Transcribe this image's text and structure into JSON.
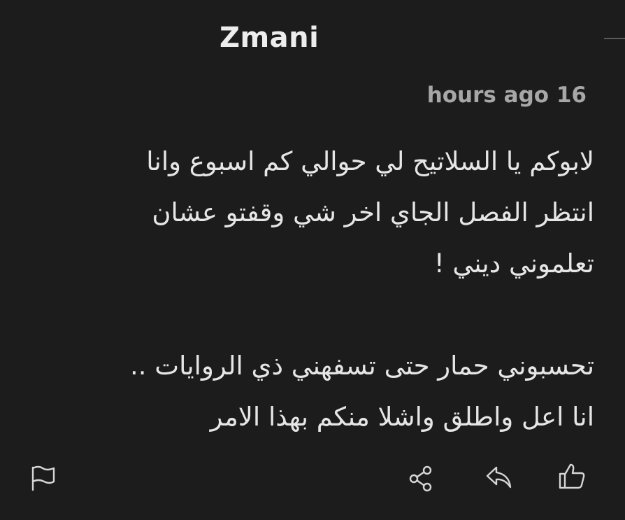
{
  "comment": {
    "username": "Zmani",
    "timestamp": "hours ago 16",
    "body_lines": [
      "لابوكم يا السلاتيح لي حوالي كم اسبوع وانا",
      "انتظر الفصل الجاي اخر شي وقفتو عشان",
      "تعلموني ديني !",
      "تحسبوني حمار حتى تسفهني ذي الروايات ..",
      "انا اعل واطلق واشلا منكم بهذا الامر"
    ]
  },
  "actions": {
    "flag_icon": "flag-icon",
    "share_icon": "share-icon",
    "reply_icon": "reply-icon",
    "like_icon": "thumbs-up-icon"
  },
  "colors": {
    "background": "#1c1c1c",
    "username": "#ededed",
    "timestamp": "#a7a7a7",
    "body_text": "#e6e6e6",
    "icon": "#d6d6d6"
  }
}
